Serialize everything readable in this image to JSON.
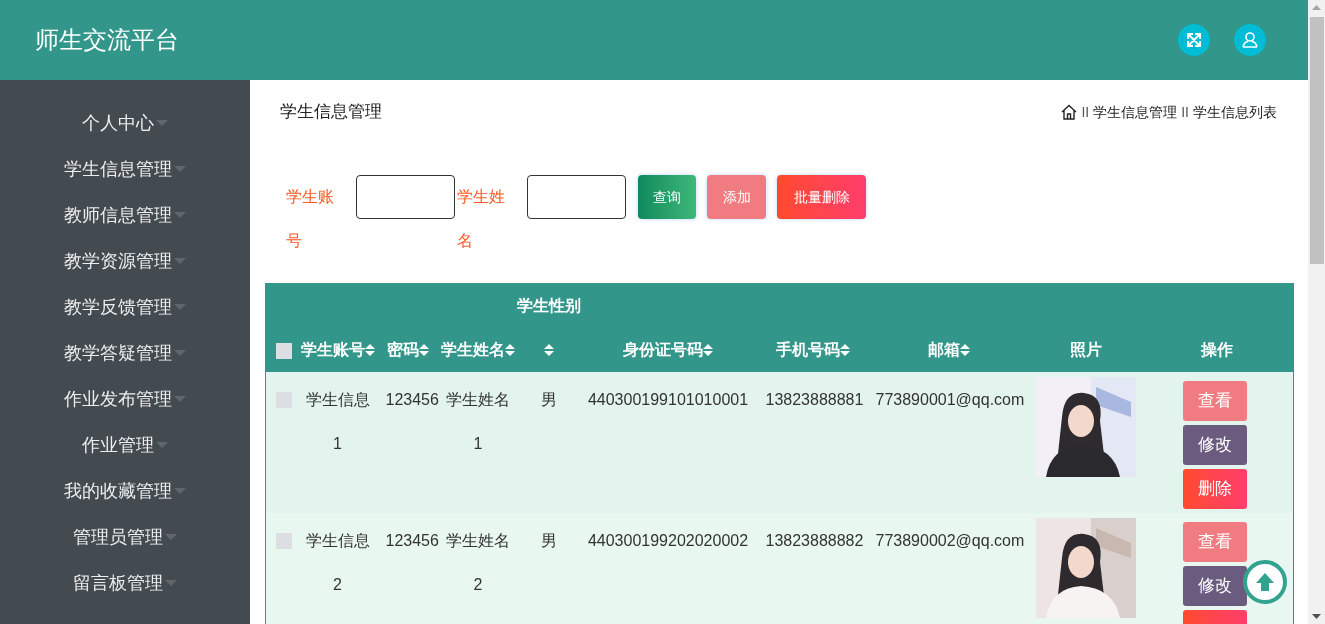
{
  "header": {
    "title": "师生交流平台"
  },
  "sidebar": {
    "items": [
      {
        "label": "个人中心"
      },
      {
        "label": "学生信息管理"
      },
      {
        "label": "教师信息管理"
      },
      {
        "label": "教学资源管理"
      },
      {
        "label": "教学反馈管理"
      },
      {
        "label": "教学答疑管理"
      },
      {
        "label": "作业发布管理"
      },
      {
        "label": "作业管理"
      },
      {
        "label": "我的收藏管理"
      },
      {
        "label": "管理员管理"
      },
      {
        "label": "留言板管理"
      }
    ]
  },
  "page": {
    "title": "学生信息管理",
    "breadcrumb": [
      {
        "separator": "II",
        "label": "学生信息管理"
      },
      {
        "separator": "II",
        "label": "学生信息列表"
      }
    ]
  },
  "search": {
    "fields": [
      {
        "label": "学生账号"
      },
      {
        "label": "学生姓名"
      }
    ],
    "buttons": [
      {
        "label": "查询",
        "kind": "query"
      },
      {
        "label": "添加",
        "kind": "add"
      },
      {
        "label": "批量删除",
        "kind": "batch-delete"
      }
    ]
  },
  "table": {
    "select_all": {
      "checked": false
    },
    "columns": [
      {
        "label": "学生账号",
        "sortable": true
      },
      {
        "label": "密码",
        "sortable": true
      },
      {
        "label": "学生姓名",
        "sortable": true
      },
      {
        "label": "学生性别",
        "sortable": true
      },
      {
        "label": "身份证号码",
        "sortable": true
      },
      {
        "label": "手机号码",
        "sortable": true
      },
      {
        "label": "邮箱",
        "sortable": true
      },
      {
        "label": "照片",
        "sortable": false
      },
      {
        "label": "操作",
        "sortable": false
      }
    ],
    "rows": [
      {
        "checked": false,
        "cells": [
          "学生信息1",
          "123456",
          "学生姓名1",
          "男",
          "440300199101010001",
          "13823888881",
          "773890001@qq.com"
        ],
        "actions": [
          {
            "label": "查看",
            "kind": "view"
          },
          {
            "label": "修改",
            "kind": "edit"
          },
          {
            "label": "删除",
            "kind": "delete"
          }
        ]
      },
      {
        "checked": false,
        "cells": [
          "学生信息2",
          "123456",
          "学生姓名2",
          "男",
          "440300199202020002",
          "13823888882",
          "773890002@qq.com"
        ],
        "actions": [
          {
            "label": "查看",
            "kind": "view"
          },
          {
            "label": "修改",
            "kind": "edit"
          },
          {
            "kind": "delete"
          }
        ]
      }
    ]
  }
}
